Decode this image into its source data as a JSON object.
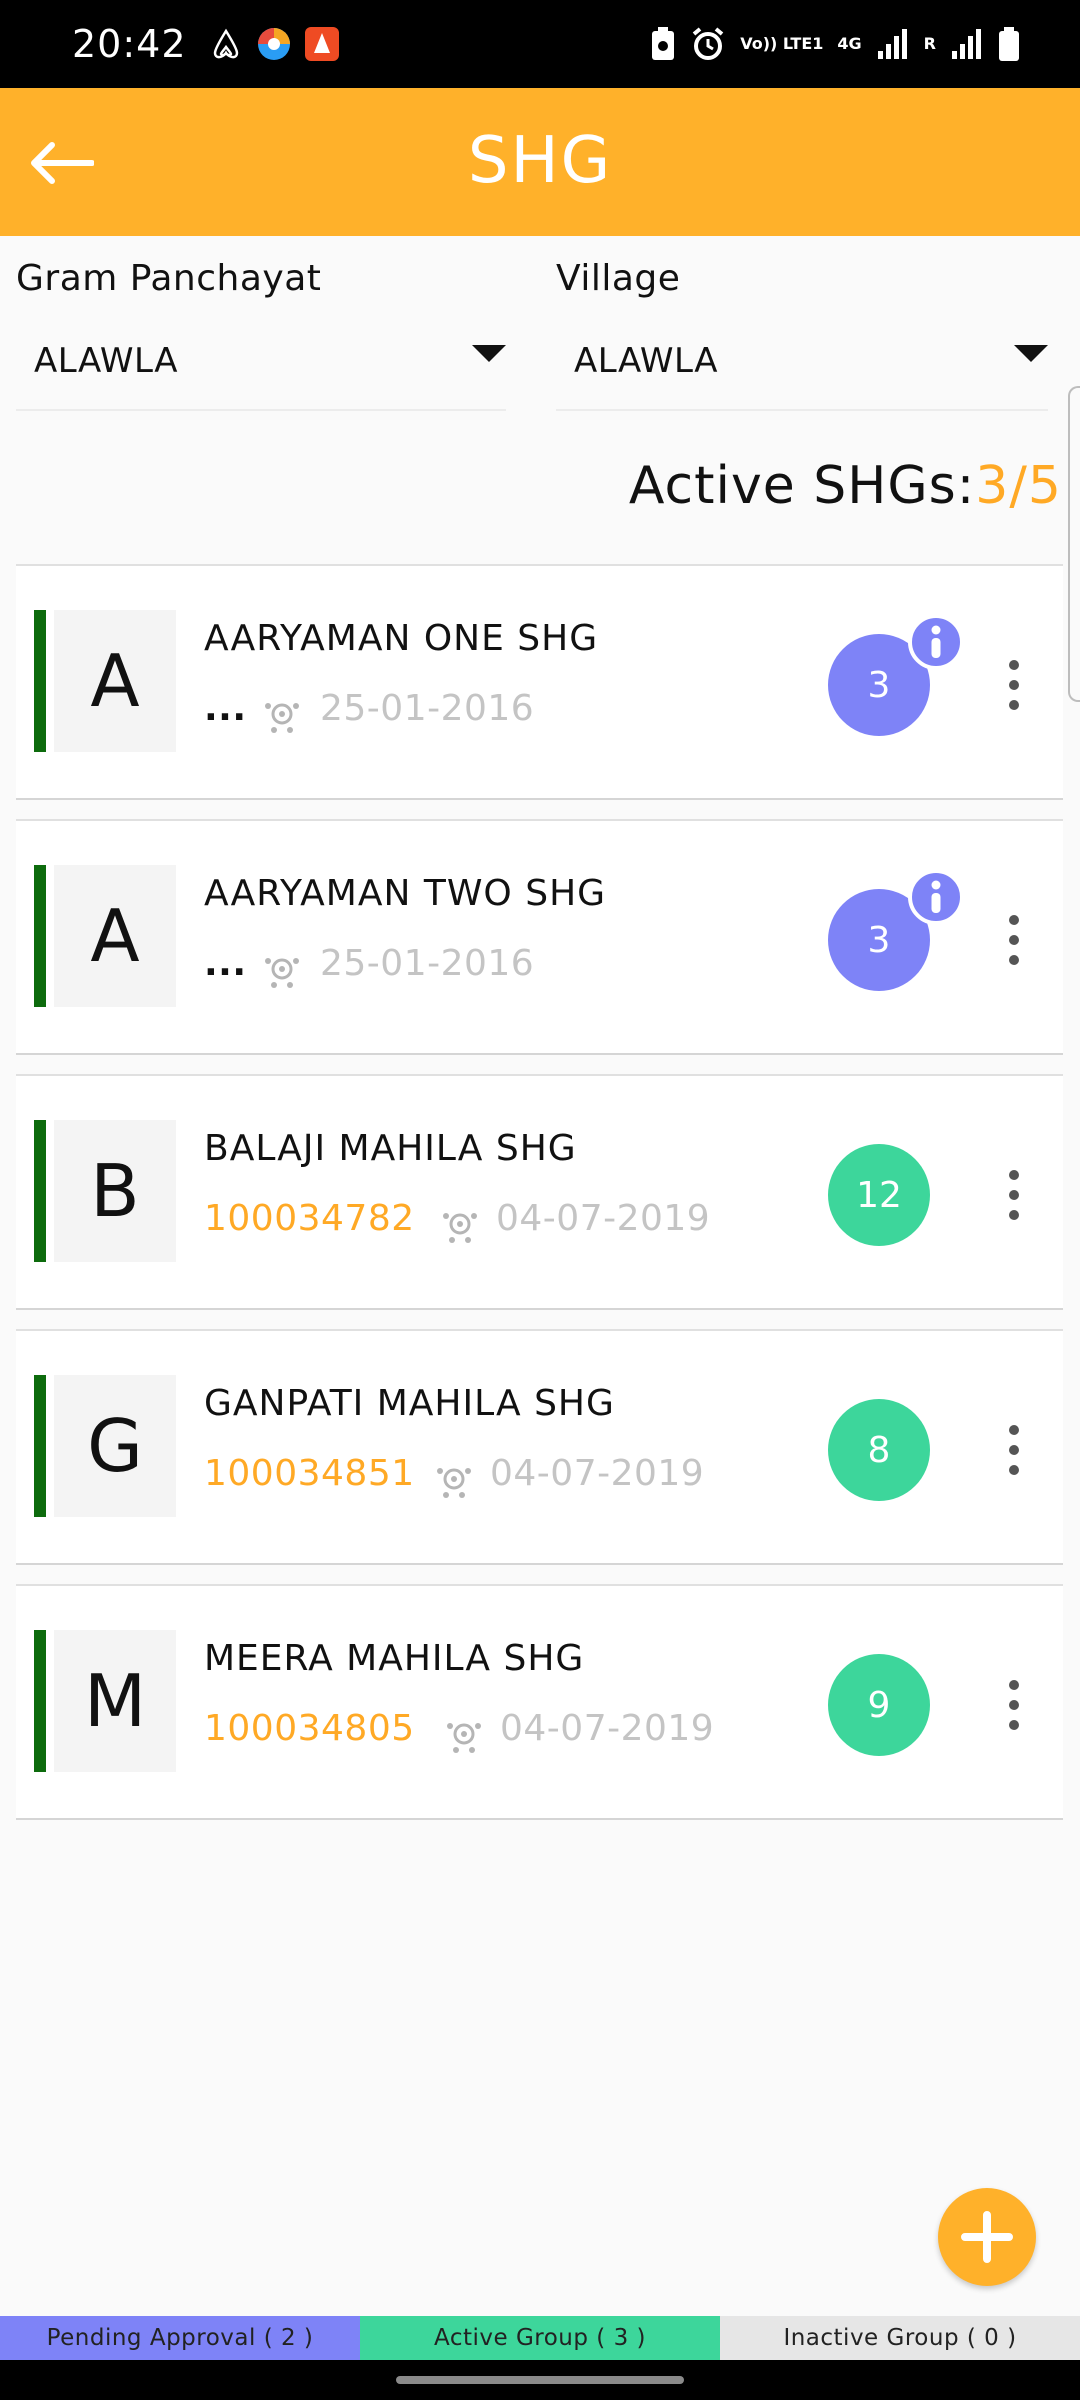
{
  "status_bar": {
    "time": "20:42",
    "volte_label": "Vo)) LTE1",
    "network_label": "4G",
    "roaming_label": "R"
  },
  "app_bar": {
    "title": "SHG"
  },
  "filters": {
    "gram_panchayat": {
      "label": "Gram Panchayat",
      "value": "ALAWLA"
    },
    "village": {
      "label": "Village",
      "value": "ALAWLA"
    }
  },
  "active_summary": {
    "label": "Active SHGs:",
    "active": "3",
    "separator": "/",
    "total": "5"
  },
  "shg_list": [
    {
      "initial": "A",
      "name": "AARYAMAN ONE SHG",
      "code": "...",
      "date": "25-01-2016",
      "members": "3",
      "badge": "purple",
      "info": true
    },
    {
      "initial": "A",
      "name": "AARYAMAN TWO SHG",
      "code": "...",
      "date": "25-01-2016",
      "members": "3",
      "badge": "purple",
      "info": true
    },
    {
      "initial": "B",
      "name": "BALAJI MAHILA SHG",
      "code": "100034782",
      "date": "04-07-2019",
      "members": "12",
      "badge": "green",
      "info": false
    },
    {
      "initial": "G",
      "name": "GANPATI MAHILA SHG",
      "code": "100034851",
      "date": "04-07-2019",
      "members": "8",
      "badge": "green",
      "info": false
    },
    {
      "initial": "M",
      "name": "MEERA MAHILA SHG",
      "code": "100034805",
      "date": "04-07-2019",
      "members": "9",
      "badge": "green",
      "info": false
    }
  ],
  "bottom_tabs": {
    "pending": "Pending Approval ( 2 )",
    "active": "Active Group ( 3 )",
    "inactive": "Inactive Group ( 0 )"
  },
  "colors": {
    "primary": "#ffb12a",
    "accent_orange": "#ffa925",
    "badge_purple": "#7e83f7",
    "badge_green": "#3dd69b",
    "accent_bar": "#0d6b0d"
  },
  "icons": {
    "back": "arrow-left-icon",
    "fab": "plus-icon",
    "meeting": "meeting-group-icon",
    "info": "info-icon",
    "more": "more-vertical-icon"
  }
}
